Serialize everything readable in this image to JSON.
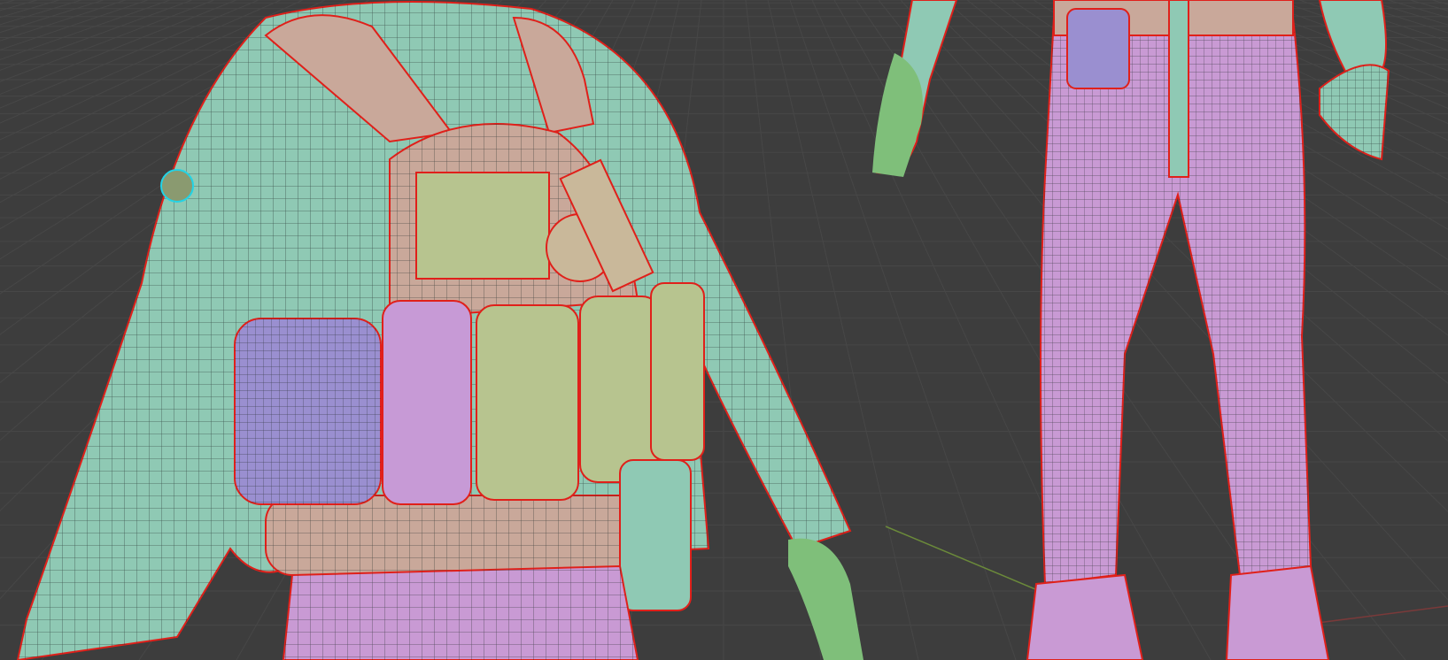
{
  "colors": {
    "background": "#3d3d3d",
    "grid": "#474747",
    "jacket": "#8fc9b4",
    "vest": "#c9a89a",
    "pouch_purple": "#9a8fd0",
    "pouch_pink": "#c79ad6",
    "pouch_green": "#b7c48f",
    "pants": "#c99ad4",
    "skin": "#7fbf7a",
    "seam": "#e0201a",
    "wire": "#1f2a28",
    "uv_edge": "#22d3e6",
    "x_axis": "#7a3a3a",
    "y_axis": "#6b8a3a"
  },
  "views": [
    "left-closeup-torso",
    "right-legs-rear"
  ]
}
